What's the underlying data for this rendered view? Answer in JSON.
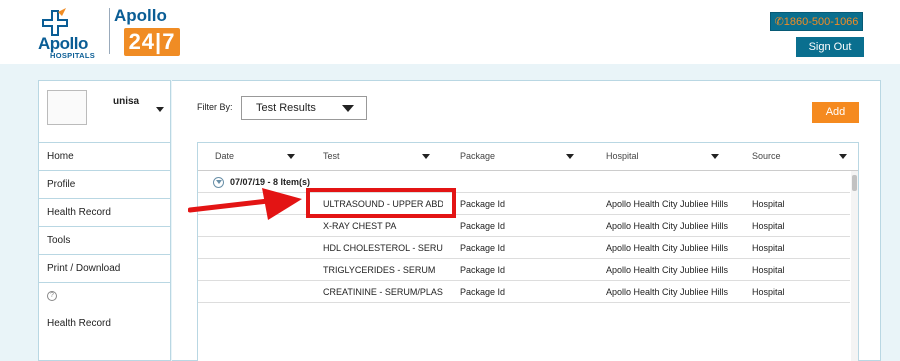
{
  "header": {
    "apollo_brand": "Apollo",
    "apollo_sub": "HOSPITALS",
    "brand_247_top": "Apollo",
    "brand_247_box": "24|7",
    "phone": "1860-500-1066",
    "signout_label": "Sign Out"
  },
  "sidebar": {
    "username": "unisa",
    "items": [
      {
        "label": "Home"
      },
      {
        "label": "Profile"
      },
      {
        "label": "Health Record"
      },
      {
        "label": "Tools"
      },
      {
        "label": "Print / Download"
      }
    ],
    "help_glyph": "?",
    "bottom_label": "Health Record"
  },
  "main": {
    "filter_label": "Filter By:",
    "filter_value": "Test Results",
    "add_label": "Add"
  },
  "table": {
    "columns": [
      {
        "label": "Date"
      },
      {
        "label": "Test"
      },
      {
        "label": "Package"
      },
      {
        "label": "Hospital"
      },
      {
        "label": "Source"
      }
    ],
    "group_label": "07/07/19 - 8 Item(s)",
    "rows": [
      {
        "date": "",
        "test": "ULTRASOUND - UPPER ABDOMEN",
        "package": "Package Id",
        "hospital": "Apollo Health City Jubliee Hills",
        "source": "Hospital"
      },
      {
        "date": "",
        "test": "X-RAY CHEST PA",
        "package": "Package Id",
        "hospital": "Apollo Health City Jubliee Hills",
        "source": "Hospital"
      },
      {
        "date": "",
        "test": "HDL CHOLESTEROL - SERUM / PLASMA",
        "package": "Package Id",
        "hospital": "Apollo Health City Jubliee Hills",
        "source": "Hospital"
      },
      {
        "date": "",
        "test": "TRIGLYCERIDES - SERUM",
        "package": "Package Id",
        "hospital": "Apollo Health City Jubliee Hills",
        "source": "Hospital"
      },
      {
        "date": "",
        "test": "CREATININE - SERUM/PLASMA",
        "package": "Package Id",
        "hospital": "Apollo Health City Jubliee Hills",
        "source": "Hospital"
      }
    ]
  },
  "colors": {
    "brand_blue": "#0a5d95",
    "brand_orange": "#f08c24",
    "button_teal": "#0a6f8f",
    "highlight_red": "#e31414"
  }
}
